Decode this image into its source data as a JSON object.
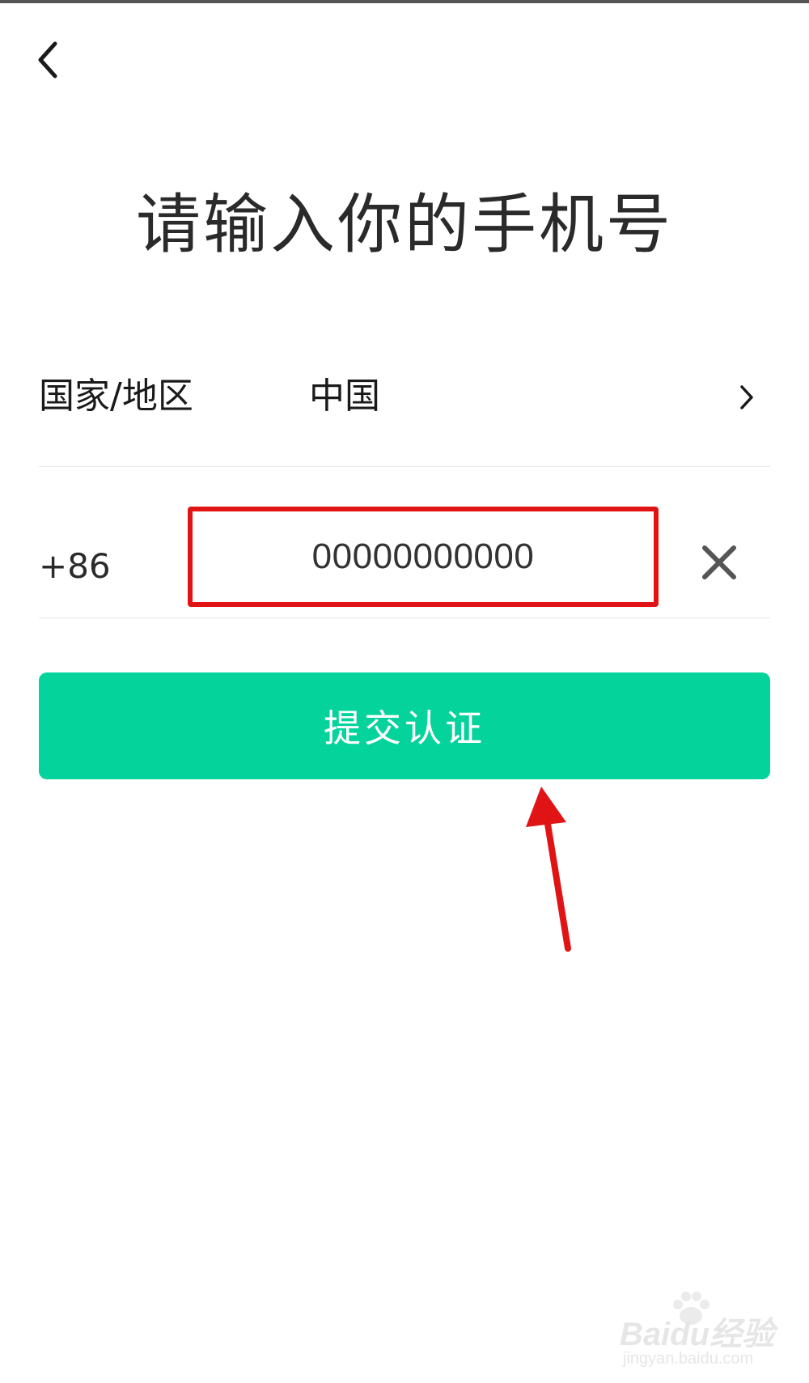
{
  "header": {
    "back_icon": "chevron-left-icon"
  },
  "title": "请输入你的手机号",
  "region": {
    "label": "国家/地区",
    "value": "中国",
    "chevron_icon": "chevron-right-icon"
  },
  "phone": {
    "country_code": "+86",
    "value": "00000000000",
    "clear_icon": "close-icon"
  },
  "submit": {
    "label": "提交认证"
  },
  "annotations": {
    "highlight_color": "#e01414",
    "arrow_color": "#e01414"
  },
  "colors": {
    "accent": "#04d39c",
    "text": "#2a2a2a"
  },
  "watermark": {
    "brand": "Baidu经验",
    "url": "jingyan.baidu.com"
  }
}
